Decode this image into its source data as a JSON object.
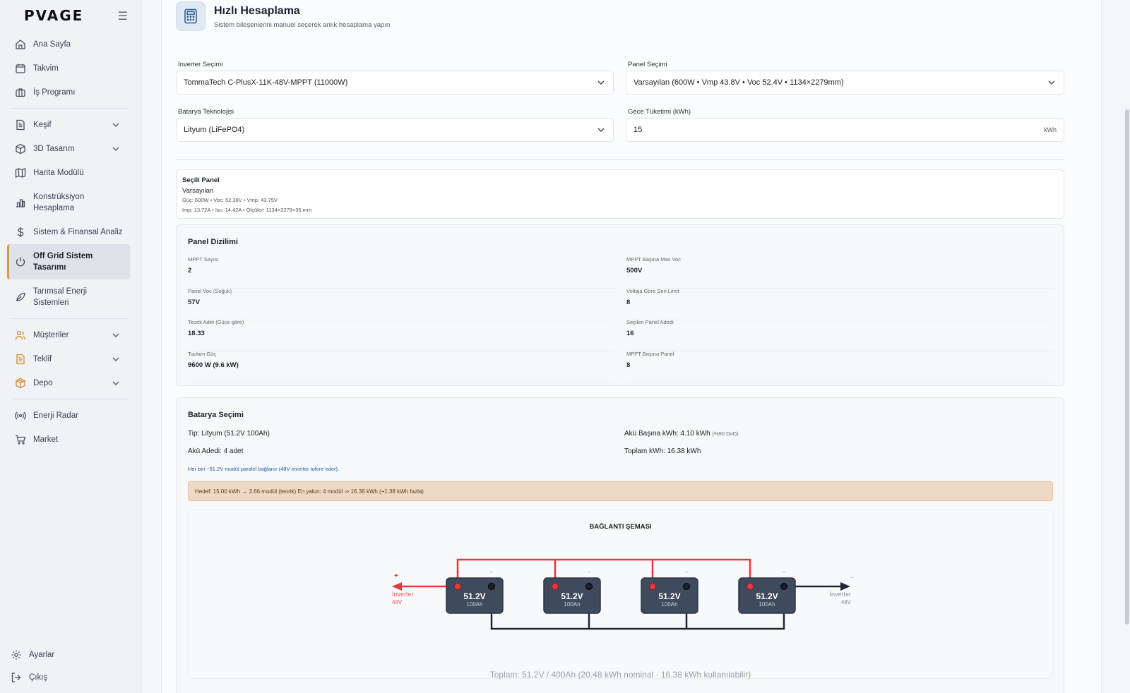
{
  "app": {
    "logo": "PVAGE"
  },
  "sidebar": {
    "items": [
      {
        "label": "Ana Sayfa"
      },
      {
        "label": "Takvim"
      },
      {
        "label": "İş Programı"
      },
      {
        "label": "Keşif"
      },
      {
        "label": "3D Tasarım"
      },
      {
        "label": "Harita Modülü"
      },
      {
        "label": "Konstrüksiyon Hesaplama"
      },
      {
        "label": "Sistem & Finansal Analiz"
      },
      {
        "label": "Off Grid Sistem Tasarımı"
      },
      {
        "label": "Tarımsal Enerji Sistemleri"
      },
      {
        "label": "Müşteriler"
      },
      {
        "label": "Teklif"
      },
      {
        "label": "Depo"
      },
      {
        "label": "Enerji Radar"
      },
      {
        "label": "Market"
      }
    ],
    "bottom": [
      {
        "label": "Ayarlar"
      },
      {
        "label": "Çıkış"
      }
    ]
  },
  "header": {
    "title": "Hızlı Hesaplama",
    "subtitle": "Sistem bileşenlerini manuel seçerek anlık hesaplama yapın"
  },
  "form": {
    "inverter_label": "İnverter Seçimi",
    "inverter_value": "TommaTech C-PlusX-11K-48V-MPPT (11000W)",
    "panel_label": "Panel Seçimi",
    "panel_value": "Varsayılan (600W • Vmp 43.8V • Voc 52.4V • 1134×2279mm)",
    "battery_label": "Batarya Teknolojisi",
    "battery_value": "Lityum (LiFePO4)",
    "night_label": "Gece Tüketimi (kWh)",
    "night_value": "15",
    "night_unit": "kWh"
  },
  "selected_panel": {
    "title": "Seçili Panel",
    "name": "Varsayılan",
    "line1": "Güç: 600W • Voc: 52.38V • Vmp: 43.75V",
    "line2": "Imp: 13.72A • Isc: 14.42A • Ölçüler: 1134×2279×35 mm"
  },
  "panel_array": {
    "title": "Panel Dizilimi",
    "left": [
      {
        "k": "MPPT Sayısı",
        "v": "2"
      },
      {
        "k": "Panel Voc (Soğuk)",
        "v": "57V"
      },
      {
        "k": "Teorik Adet (Güce göre)",
        "v": "18.33"
      },
      {
        "k": "Toplam Güç",
        "v": "9600 W (9.6 kW)"
      }
    ],
    "right": [
      {
        "k": "MPPT Başına Max Voc",
        "v": "500V"
      },
      {
        "k": "Voltaja Göre Seri Limit",
        "v": "8"
      },
      {
        "k": "Seçilen Panel Adedi",
        "v": "16"
      },
      {
        "k": "MPPT Başına Panel",
        "v": "8"
      }
    ]
  },
  "battery": {
    "title": "Batarya Seçimi",
    "type_label": "Tip:",
    "type_value": "Lityum (51.2V 100Ah)",
    "count_label": "Akü Adedi:",
    "count_value": "4 adet",
    "per_label": "Akü Başına kWh:",
    "per_value": "4.10 kWh",
    "per_note": "(%90 DoD)",
    "total_label": "Toplam kWh:",
    "total_value": "16.38 kWh",
    "note": "Her biri ~51.2V modül paralel bağlanır (48V inverter tolere eder).",
    "warning": "Hedef: 15.00 kWh → 3.66 modül (teorik) En yakın: 4 modül ⇒ 16.38 kWh (+1.38 kWh fazla)"
  },
  "scheme": {
    "title": "BAĞLANTI ŞEMASI",
    "module_voltage": "51.2V",
    "module_capacity": "100Ah",
    "module_count": 4,
    "plus": "+",
    "minus": "−",
    "inverter_label": "İnverter",
    "inverter_voltage": "48V",
    "total": "Toplam: 51.2V / 400Ah (20.48 kWh nominal · 16.38 kWh kullanılabilir)"
  },
  "colors": {
    "positive": "#e5393e",
    "negative": "#1f2636",
    "battery": "#3f4a5c",
    "active_accent": "#d99a3a"
  }
}
